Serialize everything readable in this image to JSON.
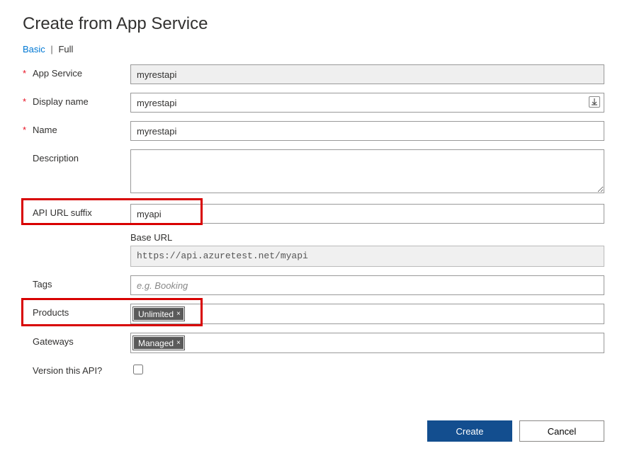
{
  "title": "Create from App Service",
  "tabs": {
    "basic": "Basic",
    "full": "Full"
  },
  "labels": {
    "appService": "App Service",
    "displayName": "Display name",
    "name": "Name",
    "description": "Description",
    "apiUrlSuffix": "API URL suffix",
    "baseUrl": "Base URL",
    "tags": "Tags",
    "products": "Products",
    "gateways": "Gateways",
    "versionThisApi": "Version this API?"
  },
  "values": {
    "appService": "myrestapi",
    "displayName": "myrestapi",
    "name": "myrestapi",
    "description": "",
    "apiUrlSuffix": "myapi",
    "baseUrl": "https://api.azuretest.net/myapi",
    "tags": "",
    "versionThisApi": false
  },
  "placeholders": {
    "tags": "e.g. Booking"
  },
  "chips": {
    "products": "Unlimited",
    "gateways": "Managed"
  },
  "buttons": {
    "create": "Create",
    "cancel": "Cancel"
  }
}
